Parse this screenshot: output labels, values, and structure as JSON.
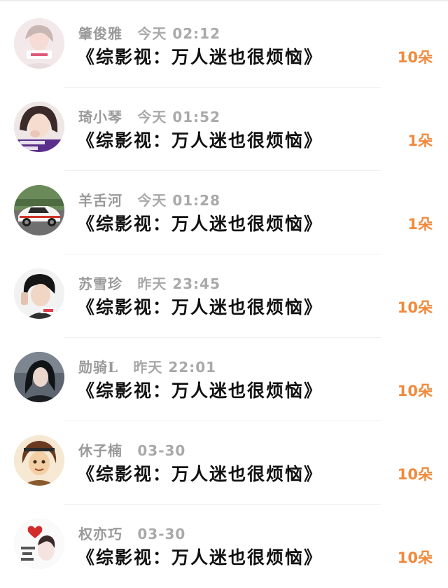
{
  "rows": [
    {
      "name": "肇俊雅",
      "time": "今天 02:12",
      "title": "《综影视：万人迷也很烦恼》",
      "flowers": "10朵",
      "avatar_icon": "girl-portrait-avatar"
    },
    {
      "name": "琦小琴",
      "time": "今天 01:52",
      "title": "《综影视：万人迷也很烦恼》",
      "flowers": "1朵",
      "avatar_icon": "girl-selfie-avatar"
    },
    {
      "name": "羊舌河",
      "time": "今天 01:28",
      "title": "《综影视：万人迷也很烦恼》",
      "flowers": "1朵",
      "avatar_icon": "sports-car-avatar"
    },
    {
      "name": "苏雪珍",
      "time": "昨天 23:45",
      "title": "《综影视：万人迷也很烦恼》",
      "flowers": "10朵",
      "avatar_icon": "boy-portrait-avatar"
    },
    {
      "name": "勋骑L",
      "time": "昨天 22:01",
      "title": "《综影视：万人迷也很烦恼》",
      "flowers": "10朵",
      "avatar_icon": "dark-hair-woman-avatar"
    },
    {
      "name": "休子楠",
      "time": "03-30",
      "title": "《综影视：万人迷也很烦恼》",
      "flowers": "10朵",
      "avatar_icon": "cartoon-character-avatar"
    },
    {
      "name": "权亦巧",
      "time": "03-30",
      "title": "《综影视：万人迷也很烦恼》",
      "flowers": "10朵",
      "avatar_icon": "love-heart-avatar"
    }
  ],
  "colors": {
    "flowers": "#f08a3c",
    "title": "#111111",
    "meta": "#9b9b9b"
  }
}
